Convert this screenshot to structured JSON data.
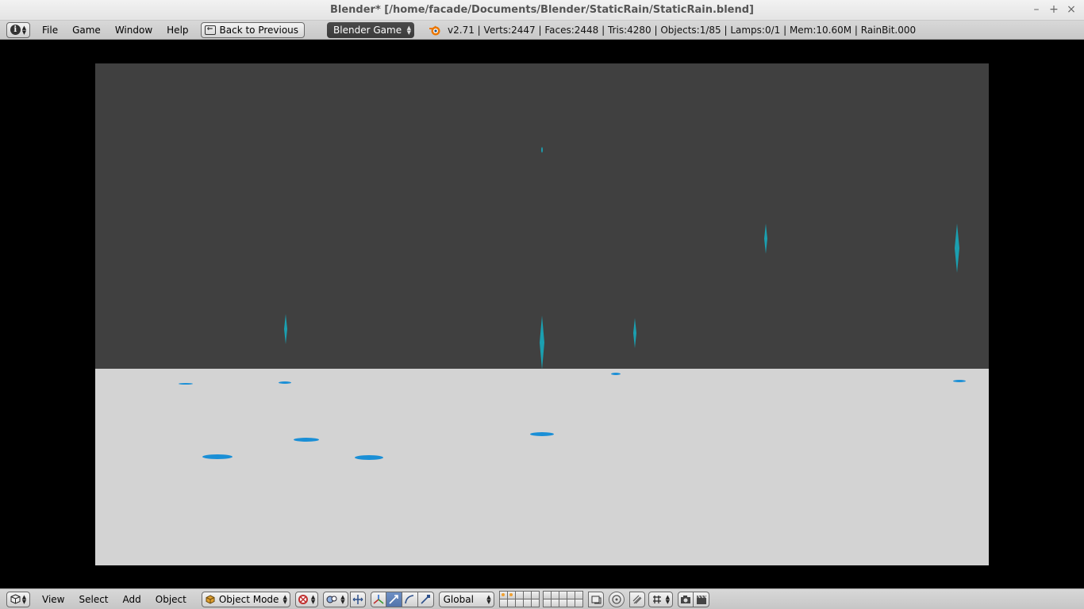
{
  "window": {
    "title": "Blender* [/home/facade/Documents/Blender/StaticRain/StaticRain.blend]",
    "controls": [
      "–",
      "+",
      "×"
    ]
  },
  "info_header": {
    "editor_type_icon": "info-icon",
    "menus": [
      "File",
      "Game",
      "Window",
      "Help"
    ],
    "back_button_label": "Back to Previous",
    "engine_select": "Blender Game",
    "stats": "v2.71 | Verts:2447 | Faces:2448 | Tris:4280 | Objects:1/85 | Lamps:0/1 | Mem:10.60M | RainBit.000"
  },
  "viewport": {
    "sky_color": "#404040",
    "ground_color": "#d3d3d3",
    "drop_color": "#1b9fb0",
    "splash_color": "#1a8fd6"
  },
  "view3d_header": {
    "editor_type_icon": "cube-icon",
    "menus": [
      "View",
      "Select",
      "Add",
      "Object"
    ],
    "mode_select": "Object Mode",
    "orientation_select": "Global"
  }
}
